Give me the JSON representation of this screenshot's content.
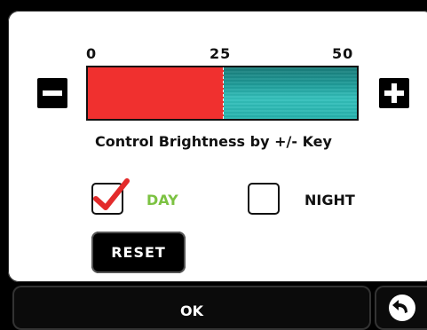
{
  "scale": {
    "min_label": "0",
    "mid_label": "25",
    "max_label": "50"
  },
  "brightness": {
    "value": 25,
    "max": 50,
    "fill_color": "#f0302f",
    "track_color": "#25a9a5"
  },
  "caption": "Control Brightness by +/- Key",
  "modes": {
    "day": {
      "label": "DAY",
      "checked": true,
      "color": "#7cc242"
    },
    "night": {
      "label": "NIGHT",
      "checked": false,
      "color": "#111111"
    }
  },
  "buttons": {
    "decrease_icon": "minus-icon",
    "increase_icon": "plus-icon",
    "reset_label": "RESET",
    "ok_label": "OK",
    "back_icon": "back-arrow-icon"
  },
  "colors": {
    "check_mark": "#e32b2b"
  }
}
